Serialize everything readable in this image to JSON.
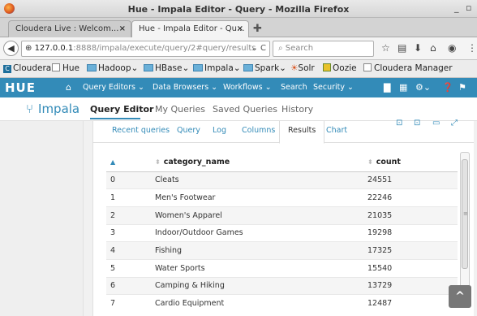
{
  "window": {
    "title": "Hue - Impala Editor - Query - Mozilla Firefox",
    "minimize": "_",
    "maximize": "▫"
  },
  "tabs": [
    {
      "label": "Cloudera Live : Welcom...",
      "close": "×"
    },
    {
      "label": "Hue - Impala Editor - Qu...",
      "close": "×"
    }
  ],
  "new_tab": "✚",
  "url": {
    "host": "127.0.0.1",
    "path": ":8888/impala/execute/query/2#query/results",
    "controls": "⌄ C"
  },
  "search": {
    "placeholder": "Search"
  },
  "bookmarks": [
    {
      "label": "Cloudera",
      "icon": "cloudera-icon"
    },
    {
      "label": "Hue",
      "icon": "checkbox-icon"
    },
    {
      "label": "Hadoop",
      "icon": "folder-icon",
      "chevron": "⌄"
    },
    {
      "label": "HBase",
      "icon": "folder-icon",
      "chevron": "⌄"
    },
    {
      "label": "Impala",
      "icon": "folder-icon",
      "chevron": "⌄"
    },
    {
      "label": "Spark",
      "icon": "folder-icon",
      "chevron": "⌄"
    },
    {
      "label": "Solr",
      "icon": "solr-icon"
    },
    {
      "label": "Oozie",
      "icon": "oozie-icon"
    },
    {
      "label": "Cloudera Manager",
      "icon": "checkbox-icon"
    }
  ],
  "hue_nav": {
    "logo": "HUE",
    "items": [
      {
        "label": "Query Editors ⌄"
      },
      {
        "label": "Data Browsers ⌄"
      },
      {
        "label": "Workflows ⌄"
      },
      {
        "label": "Search"
      },
      {
        "label": "Security ⌄"
      }
    ]
  },
  "app_header": {
    "app_name": "Impala",
    "tabs": [
      {
        "label": "Query Editor",
        "active": true
      },
      {
        "label": "My Queries"
      },
      {
        "label": "Saved Queries"
      },
      {
        "label": "History"
      }
    ]
  },
  "sub_tabs": [
    {
      "label": "Recent queries"
    },
    {
      "label": "Query"
    },
    {
      "label": "Log"
    },
    {
      "label": "Columns"
    },
    {
      "label": "Results",
      "active": true
    },
    {
      "label": "Chart"
    }
  ],
  "results": {
    "columns": [
      "",
      "category_name",
      "count"
    ],
    "rows": [
      [
        "0",
        "Cleats",
        "24551"
      ],
      [
        "1",
        "Men's Footwear",
        "22246"
      ],
      [
        "2",
        "Women's Apparel",
        "21035"
      ],
      [
        "3",
        "Indoor/Outdoor Games",
        "19298"
      ],
      [
        "4",
        "Fishing",
        "17325"
      ],
      [
        "5",
        "Water Sports",
        "15540"
      ],
      [
        "6",
        "Camping & Hiking",
        "13729"
      ],
      [
        "7",
        "Cardio Equipment",
        "12487"
      ]
    ]
  },
  "colors": {
    "hue_blue": "#338bb8",
    "link": "#338bb8"
  }
}
